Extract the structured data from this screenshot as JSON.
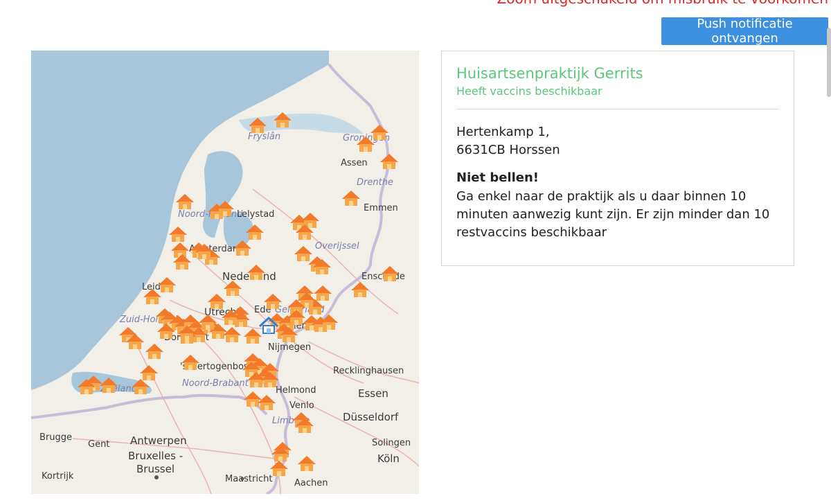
{
  "header": {
    "notice": "Zoom uitgeschakeld om misbruik te voorkomen",
    "push_label": "Push notificatie ontvangen"
  },
  "colors": {
    "notice": "#e02424",
    "button": "#3d8fe0",
    "available": "#5cc77a",
    "marker": "#f27a2a",
    "selected_marker": "#3a7bd5"
  },
  "map": {
    "places": {
      "fryslan": "Fryslân",
      "groningen": "Groningen",
      "assen": "Assen",
      "drenthe": "Drenthe",
      "emmen": "Emmen",
      "noord_holland": "Noord-Holland",
      "lelystad": "Lelystad",
      "amsterdam": "Amsterdam",
      "overijssel": "Overijssel",
      "nederland": "Nederland",
      "enschede": "Enschede",
      "leiden": "Leiden",
      "utrecht": "Utrecht",
      "ede": "Ede",
      "gelderland": "Gelderland",
      "zuid_holland": "Zuid-Holland",
      "arnhem": "Arnhem",
      "dordrecht": "Dordrecht",
      "nijmegen": "Nijmegen",
      "s_hertogenbosch": "'s-Hertogenbosch",
      "recklinghausen": "Recklinghausen",
      "zeeland": "Zeeland",
      "noord_brabant": "Noord-Brabant",
      "helmond": "Helmond",
      "essen": "Essen",
      "venlo": "Venlo",
      "limburg": "Limburg",
      "dusseldorf": "Düsseldorf",
      "brugge": "Brugge",
      "gent": "Gent",
      "antwerpen": "Antwerpen",
      "solingen": "Solingen",
      "bruxelles": "Bruxelles -",
      "brussel": "Brussel",
      "koln": "Köln",
      "kortrijk": "Kortrijk",
      "maastricht": "Maastricht",
      "aachen": "Aachen"
    },
    "marker_icon": "house-icon",
    "selected_icon": "house-selected-icon"
  },
  "practice": {
    "name": "Huisartsenpraktijk Gerrits",
    "status": "Heeft vaccins beschikbaar",
    "address_line1": "Hertenkamp 1,",
    "address_line2": "6631CB Horssen",
    "warning_title": "Niet bellen!",
    "warning_text": "Ga enkel naar de praktijk als u daar binnen 10 minuten aanwezig kunt zijn. Er zijn minder dan 10 restvaccins beschikbaar"
  }
}
